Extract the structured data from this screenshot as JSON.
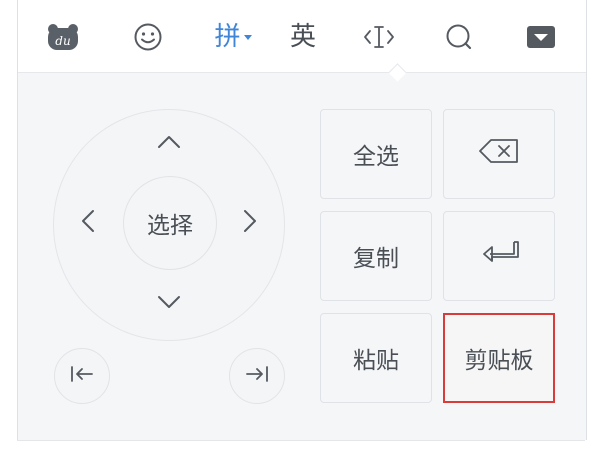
{
  "toolbar": {
    "items": [
      {
        "icon": "du-logo-icon",
        "text": "du"
      },
      {
        "icon": "smiley-icon"
      },
      {
        "label": "拼",
        "active_color": "#3f86d8"
      },
      {
        "label": "英"
      },
      {
        "icon": "text-cursor-icon"
      },
      {
        "icon": "search-icon"
      },
      {
        "icon": "keyboard-hide-icon"
      }
    ]
  },
  "dpad": {
    "center_label": "选择"
  },
  "keys": {
    "select_all": "全选",
    "copy": "复制",
    "paste": "粘贴",
    "clipboard": "剪贴板"
  },
  "colors": {
    "accent": "#3f86d8",
    "highlight_border": "#d93a3a",
    "icon": "#555a61"
  }
}
